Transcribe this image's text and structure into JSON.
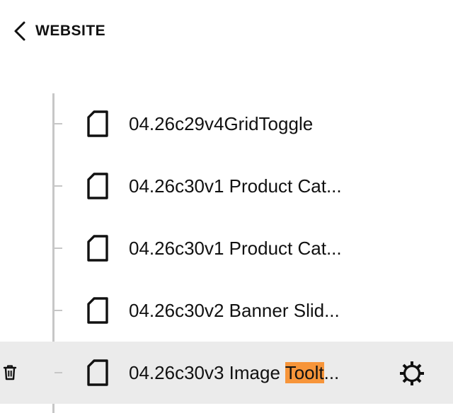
{
  "header": {
    "back_label": "WEBSITE"
  },
  "tree": {
    "items": [
      {
        "title": "04.26c29v4GridToggle",
        "title_highlight": "",
        "title_suffix": "",
        "selected": false
      },
      {
        "title": "04.26c30v1 Product Cat...",
        "title_highlight": "",
        "title_suffix": "",
        "selected": false
      },
      {
        "title": "04.26c30v1 Product Cat...",
        "title_highlight": "",
        "title_suffix": "",
        "selected": false
      },
      {
        "title": "04.26c30v2 Banner Slid...",
        "title_highlight": "",
        "title_suffix": "",
        "selected": false
      },
      {
        "title": "04.26c30v3 Image ",
        "title_highlight": "Toolt",
        "title_suffix": "...",
        "selected": true
      }
    ]
  },
  "icons": {
    "back": "chevron-left-icon",
    "page": "page-icon",
    "trash": "trash-icon",
    "settings": "gear-icon"
  },
  "colors": {
    "highlight": "#f7953a",
    "selected_row_bg": "#ebebeb",
    "tree_line": "#c7c7c7"
  }
}
